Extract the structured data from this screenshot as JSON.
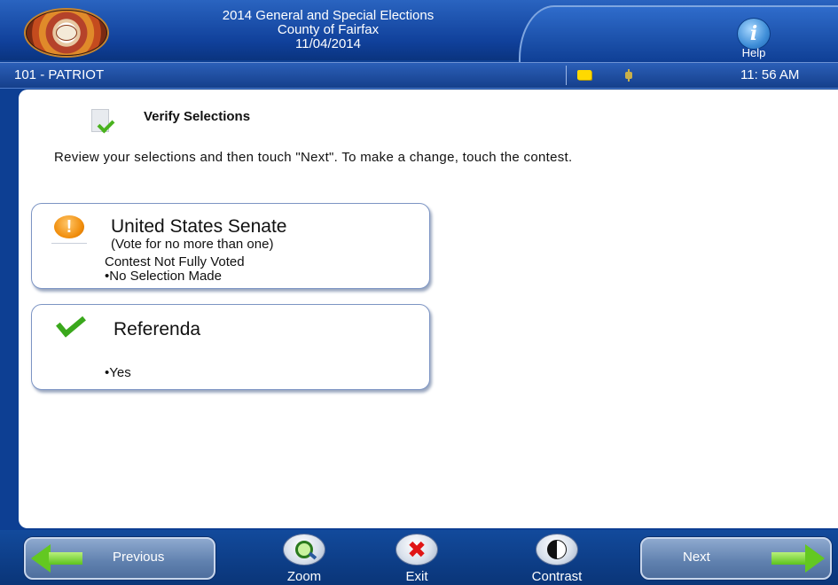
{
  "header": {
    "title_line1": "2014 General and Special Elections",
    "title_line2": "County of Fairfax",
    "title_line3": "11/04/2014",
    "help_label": "Help",
    "help_glyph": "i"
  },
  "status_bar": {
    "precinct": "101 - PATRIOT",
    "time": "11: 56 AM",
    "icons": [
      "note-icon",
      "plug-icon"
    ]
  },
  "page": {
    "title": "Verify Selections",
    "instructions": "Review your selections and then touch \"Next\".  To make a change, touch the contest."
  },
  "contests": [
    {
      "name": "United States Senate",
      "vote_for": "(Vote for no more than one)",
      "status": "Contest Not Fully Voted",
      "selection": "•No Selection Made",
      "icon": "warning-icon",
      "warning_glyph": "!"
    },
    {
      "name": "Referenda",
      "selection": "•Yes",
      "icon": "checkmark-icon"
    }
  ],
  "nav": {
    "previous_label": "Previous",
    "next_label": "Next",
    "zoom_label": "Zoom",
    "exit_label": "Exit",
    "contrast_label": "Contrast",
    "exit_glyph": "✖"
  },
  "colors": {
    "header_blue": "#10409a",
    "accent_green": "#63c821",
    "warning_orange": "#f08c0a",
    "exit_red": "#e01515"
  }
}
